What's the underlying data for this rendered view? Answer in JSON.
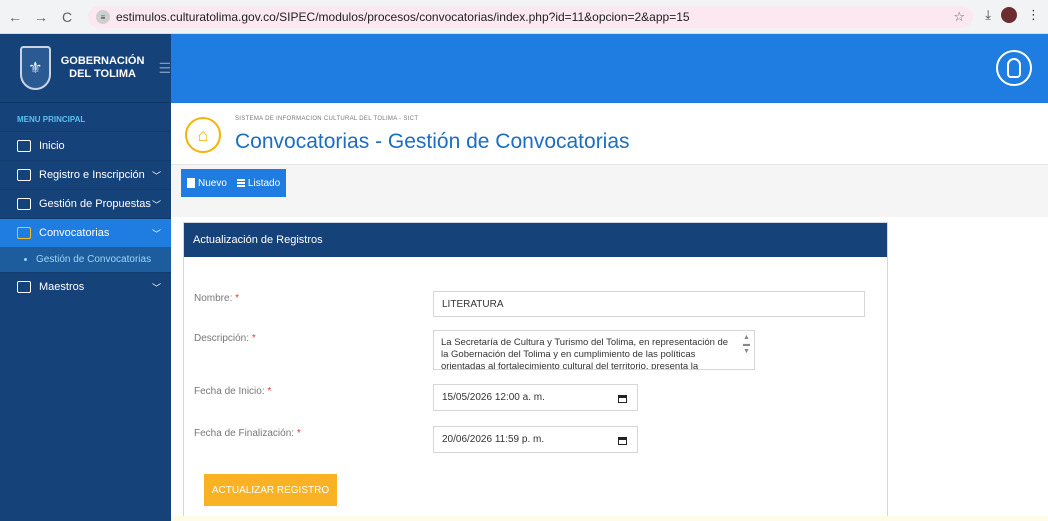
{
  "browser": {
    "url": "estimulos.culturatolima.gov.co/SIPEC/modulos/procesos/convocatorias/index.php?id=11&opcion=2&app=15",
    "back": "←",
    "forward": "→",
    "reload": "C"
  },
  "brand": {
    "line1": "GOBERNACIÓN",
    "line2": "DEL TOLIMA"
  },
  "sidebar": {
    "menu_title": "MENU PRINCIPAL",
    "items": [
      {
        "label": "Inicio"
      },
      {
        "label": "Registro e Inscripción"
      },
      {
        "label": "Gestión de Propuestas"
      },
      {
        "label": "Convocatorias"
      },
      {
        "label": "Maestros"
      }
    ],
    "submenu_label": "Gestión de Convocatorias"
  },
  "header": {
    "system_title": "SISTEMA DE INFORMACION CULTURAL DEL TOLIMA - SICT",
    "page_title": "Convocatorias - Gestión de Convocatorias"
  },
  "toolbar": {
    "new_label": "Nuevo",
    "list_label": "Listado"
  },
  "form": {
    "panel_title": "Actualización de Registros",
    "name_label": "Nombre:",
    "name_value": "LITERATURA",
    "description_label": "Descripción:",
    "description_value": "La Secretaría de Cultura y Turismo del Tolima, en representación de la Gobernación del Tolima y en cumplimiento de las políticas orientadas al fortalecimiento cultural del territorio, presenta la",
    "start_label": "Fecha de Inicio:",
    "start_value": "15/05/2026 12:00 a. m.",
    "end_label": "Fecha de Finalización:",
    "end_value": "20/06/2026 11:59 p. m.",
    "required_mark": "*",
    "submit_label": "ACTUALIZAR REGISTRO"
  },
  "colors": {
    "sidebar": "#16427a",
    "topbar": "#1f7ce0",
    "accent": "#f9b224",
    "title": "#1b6ec2"
  }
}
